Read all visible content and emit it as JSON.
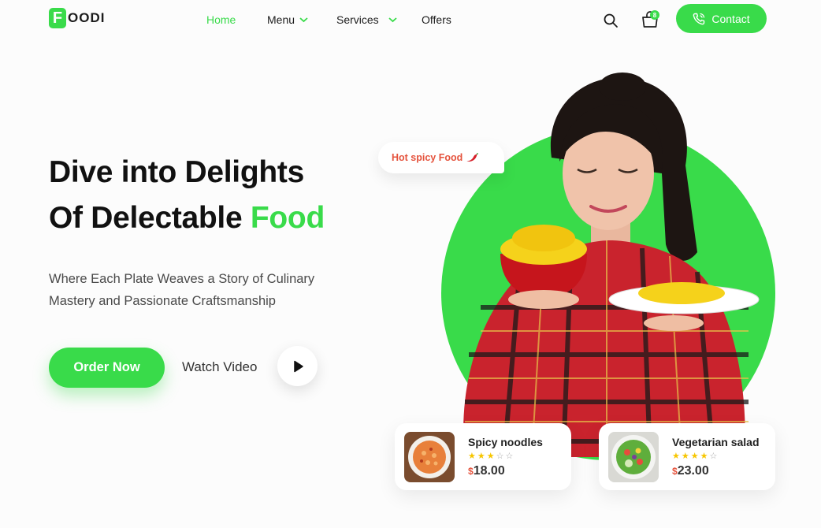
{
  "brand": {
    "logo_letter": "F",
    "logo_rest": "OODI",
    "accent_color": "#39db4a"
  },
  "nav": {
    "items": [
      {
        "label": "Home",
        "active": true,
        "has_dropdown": false
      },
      {
        "label": "Menu",
        "active": false,
        "has_dropdown": true
      },
      {
        "label": "Services",
        "active": false,
        "has_dropdown": true
      },
      {
        "label": "Offers",
        "active": false,
        "has_dropdown": false
      }
    ],
    "cart_count": "8",
    "contact_label": "Contact"
  },
  "hero": {
    "title_line1": "Dive into Delights",
    "title_line2_prefix": "Of Delectable ",
    "title_line2_accent": "Food",
    "subtitle_line1": "Where Each Plate Weaves a Story of Culinary",
    "subtitle_line2": "Mastery and Passionate Craftsmanship",
    "order_label": "Order Now",
    "watch_label": "Watch Video"
  },
  "bubble": {
    "text": "Hot spicy Food",
    "icon": "chili-icon"
  },
  "dishes": [
    {
      "name": "Spicy noodles",
      "rating": 3,
      "max": 5,
      "currency": "$",
      "price": "18.00"
    },
    {
      "name": "Vegetarian salad",
      "rating": 4,
      "max": 5,
      "currency": "$",
      "price": "23.00"
    }
  ]
}
